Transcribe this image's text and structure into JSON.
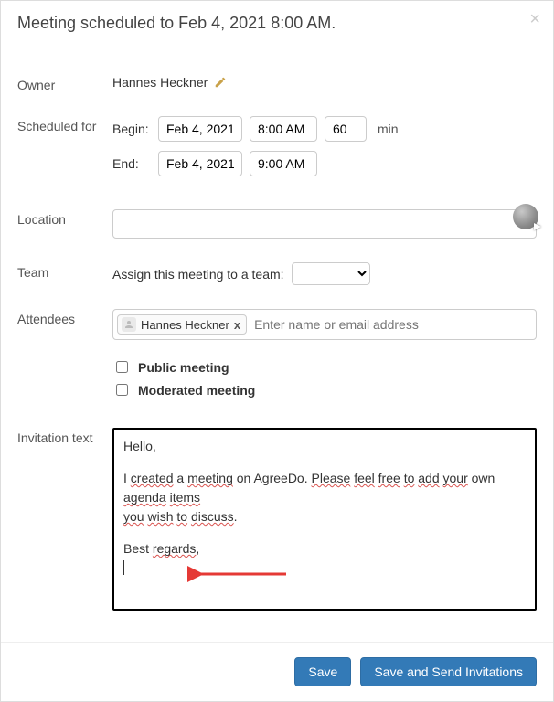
{
  "header": {
    "title": "Meeting scheduled to Feb 4, 2021 8:00 AM."
  },
  "labels": {
    "owner": "Owner",
    "scheduled_for": "Scheduled for",
    "begin": "Begin:",
    "end": "End:",
    "min": "min",
    "location": "Location",
    "team": "Team",
    "team_assign": "Assign this meeting to a team:",
    "attendees": "Attendees",
    "public": "Public meeting",
    "moderated": "Moderated meeting",
    "invitation_text": "Invitation text"
  },
  "owner": {
    "name": "Hannes Heckner"
  },
  "schedule": {
    "begin_date": "Feb 4, 2021",
    "begin_time": "8:00 AM",
    "duration": "60",
    "end_date": "Feb 4, 2021",
    "end_time": "9:00 AM"
  },
  "location": "",
  "team_selected": "",
  "attendees": {
    "chip_name": "Hannes Heckner",
    "placeholder": "Enter name or email address"
  },
  "options": {
    "public": false,
    "moderated": false
  },
  "invitation": {
    "line1": "Hello,",
    "line2_a": "I ",
    "line2_b": "created",
    "line2_c": " a ",
    "line2_d": "meeting",
    "line2_e": " on AgreeDo. ",
    "line2_f": "Please",
    "line2_g": " ",
    "line2_h": "feel",
    "line2_i": " ",
    "line2_j": "free",
    "line2_k": " ",
    "line2_l": "to",
    "line2_m": " ",
    "line2_n": "add",
    "line2_o": " ",
    "line2_p": "your",
    "line2_q": " own ",
    "line2_r": "agenda",
    "line2_s": " ",
    "line2_t": "items",
    "line3_a": "you",
    "line3_b": " ",
    "line3_c": "wish",
    "line3_d": " ",
    "line3_e": "to",
    "line3_f": " ",
    "line3_g": "discuss",
    "line3_h": ".",
    "line4_a": "Best ",
    "line4_b": "regards",
    "line4_c": ","
  },
  "footer": {
    "save": "Save",
    "save_send": "Save and Send Invitations"
  }
}
